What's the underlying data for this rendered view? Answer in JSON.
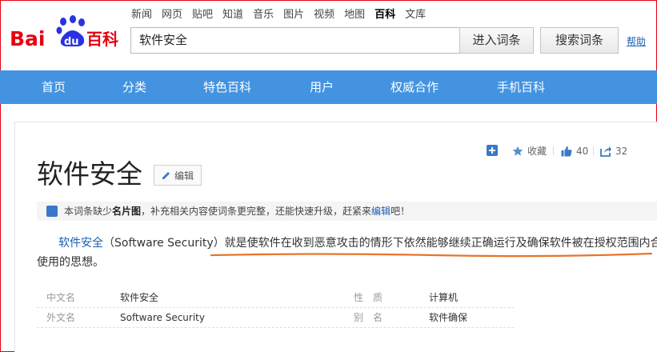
{
  "logo": {
    "text_bai": "Bai",
    "text_du": "du",
    "text_baike": "百科"
  },
  "top_nav": [
    {
      "label": "新闻",
      "active": false
    },
    {
      "label": "网页",
      "active": false
    },
    {
      "label": "贴吧",
      "active": false
    },
    {
      "label": "知道",
      "active": false
    },
    {
      "label": "音乐",
      "active": false
    },
    {
      "label": "图片",
      "active": false
    },
    {
      "label": "视频",
      "active": false
    },
    {
      "label": "地图",
      "active": false
    },
    {
      "label": "百科",
      "active": true
    },
    {
      "label": "文库",
      "active": false
    }
  ],
  "search": {
    "value": "软件安全",
    "enter_button": "进入词条",
    "search_button": "搜索词条",
    "help_link": "帮助"
  },
  "main_nav": [
    "首页",
    "分类",
    "特色百科",
    "用户",
    "权威合作",
    "手机百科"
  ],
  "actions": {
    "collect_label": "收藏",
    "like_count": "40",
    "share_count": "32"
  },
  "entry": {
    "title": "软件安全",
    "edit_label": "编辑"
  },
  "notice": {
    "prefix": "本词条缺少",
    "bold": "名片图",
    "middle": "，补充相关内容使词条更完整，还能快速升级，赶紧来",
    "link": "编辑",
    "suffix": "吧！"
  },
  "summary": {
    "link_text": "软件安全",
    "paren_text": "（Software Security）",
    "highlighted_text": "就是使软件在收到恶意攻击的情形下依然能够继续正确运行及确保软件被在授权范围内合法",
    "line2": "使用的思想。"
  },
  "basic_info": [
    {
      "key": "中文名",
      "value": "软件安全",
      "key2": "性　质",
      "value2": "计算机"
    },
    {
      "key": "外文名",
      "value": "Software Security",
      "key2": "别　名",
      "value2": "软件确保"
    }
  ],
  "colors": {
    "brand_red": "#e60012",
    "brand_blue": "#2932e1",
    "nav_blue": "#4393e0",
    "link_blue": "#1a5fb4",
    "annotation_orange": "#e8742a"
  }
}
